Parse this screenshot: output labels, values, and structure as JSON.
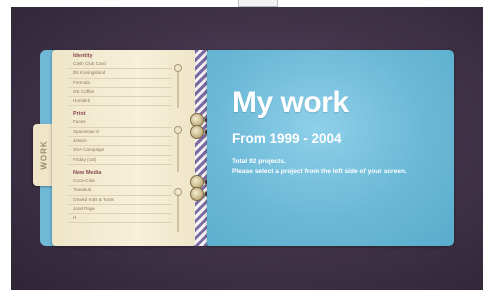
{
  "side_tab": {
    "label": "WORK"
  },
  "menu": {
    "sections": [
      {
        "title": "Identity",
        "items": [
          "Cash Club Card",
          "Dit Koningsland",
          "Formula",
          "OK Coffee",
          "Horsbirk"
        ]
      },
      {
        "title": "Print",
        "items": [
          "Faces",
          "Spaceman 8",
          "Jetson",
          "2OA Campaign",
          "Friday (cut)"
        ]
      },
      {
        "title": "New Media",
        "items": [
          "Coca-Cola",
          "Tweakuk",
          "Onwkd Kids & Tools",
          "Jood Page",
          "H"
        ]
      }
    ]
  },
  "content": {
    "title": "My work",
    "subtitle": "From 1999 - 2004",
    "total_projects": "Total 92 projects.",
    "instruction": "Please select a project from the left side of your screen."
  },
  "colors": {
    "background": "#3f3247",
    "panel_blue": "#6ab8d6",
    "paper": "#efe6c9",
    "section_title": "#8a4a52"
  }
}
